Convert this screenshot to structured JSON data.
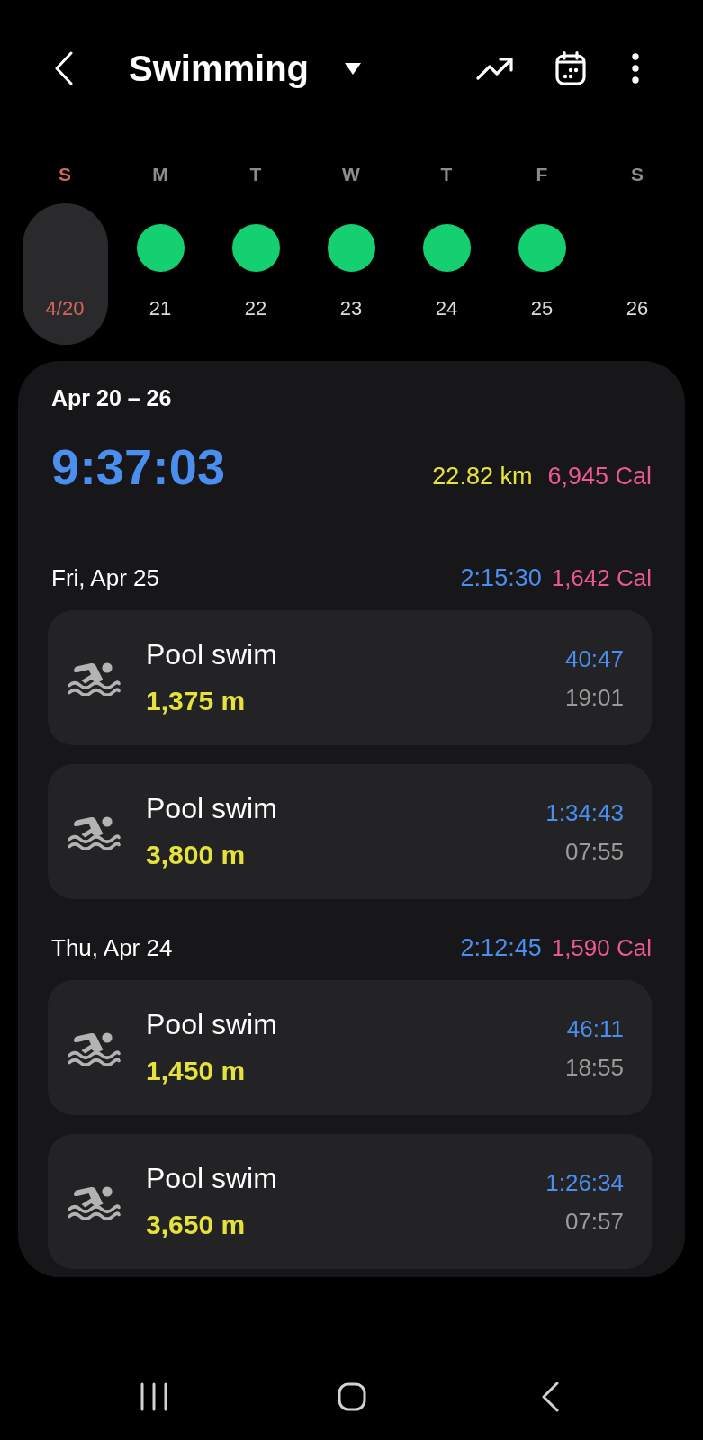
{
  "header": {
    "title": "Swimming"
  },
  "week": [
    {
      "letter": "S",
      "date": "4/20",
      "selected": true,
      "holiday": true,
      "active": false
    },
    {
      "letter": "M",
      "date": "21",
      "selected": false,
      "holiday": false,
      "active": true
    },
    {
      "letter": "T",
      "date": "22",
      "selected": false,
      "holiday": false,
      "active": true
    },
    {
      "letter": "W",
      "date": "23",
      "selected": false,
      "holiday": false,
      "active": true
    },
    {
      "letter": "T",
      "date": "24",
      "selected": false,
      "holiday": false,
      "active": true
    },
    {
      "letter": "F",
      "date": "25",
      "selected": false,
      "holiday": false,
      "active": true
    },
    {
      "letter": "S",
      "date": "26",
      "selected": false,
      "holiday": false,
      "active": false
    }
  ],
  "summary": {
    "range": "Apr 20 – 26",
    "duration": "9:37:03",
    "distance": "22.82 km",
    "calories": "6,945 Cal",
    "days": [
      {
        "date": "Fri, Apr 25",
        "duration": "2:15:30",
        "calories": "1,642 Cal",
        "workouts": [
          {
            "name": "Pool swim",
            "distance": "1,375 m",
            "duration": "40:47",
            "start": "19:01"
          },
          {
            "name": "Pool swim",
            "distance": "3,800 m",
            "duration": "1:34:43",
            "start": "07:55"
          }
        ]
      },
      {
        "date": "Thu, Apr 24",
        "duration": "2:12:45",
        "calories": "1,590 Cal",
        "workouts": [
          {
            "name": "Pool swim",
            "distance": "1,450 m",
            "duration": "46:11",
            "start": "18:55"
          },
          {
            "name": "Pool swim",
            "distance": "3,650 m",
            "duration": "1:26:34",
            "start": "07:57"
          }
        ]
      }
    ]
  }
}
